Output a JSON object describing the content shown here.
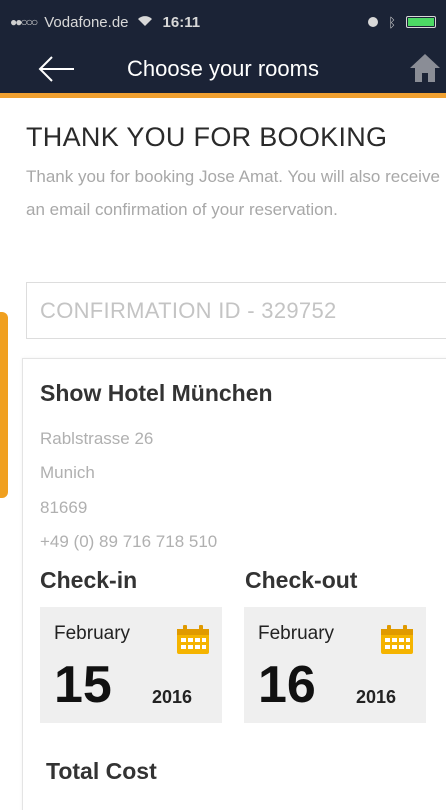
{
  "status_bar": {
    "signal": "●●○○○",
    "carrier": "Vodafone.de",
    "wifi_icon": "wifi-icon",
    "time": "16:11"
  },
  "nav": {
    "title": "Choose your rooms",
    "back_icon": "back-arrow-icon",
    "home_icon": "home-icon",
    "accent_color": "#f0a030",
    "bar_color": "#1b2336"
  },
  "booking": {
    "heading": "THANK YOU FOR BOOKING",
    "intro": "Thank you for booking Jose Amat. You will also receive an email confirmation of your reservation.",
    "confirmation": "CONFIRMATION ID - 329752"
  },
  "hotel": {
    "name": "Show Hotel München",
    "street": "Rablstrasse 26",
    "city": "Munich",
    "zip": "81669",
    "phone": "+49 (0) 89 716 718 510"
  },
  "checkin": {
    "label": "Check-in",
    "month": "February",
    "day": "15",
    "year": "2016"
  },
  "checkout": {
    "label": "Check-out",
    "month": "February",
    "day": "16",
    "year": "2016"
  },
  "total": {
    "label": "Total Cost"
  }
}
